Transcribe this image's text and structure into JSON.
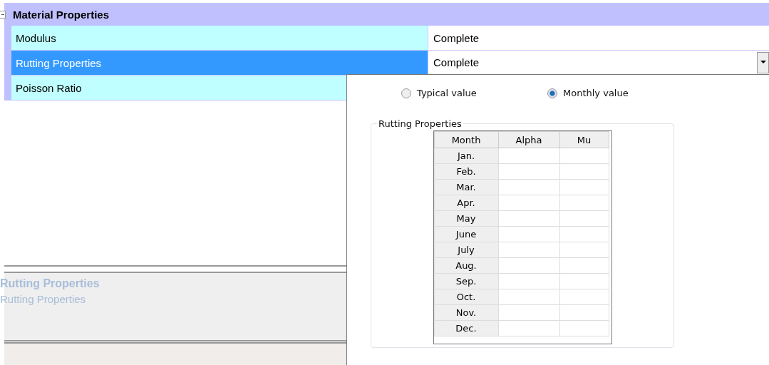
{
  "category": {
    "title": "Material Properties",
    "expanded": true
  },
  "properties": [
    {
      "name": "Modulus",
      "value": "Complete",
      "selected": false
    },
    {
      "name": "Rutting Properties",
      "value": "Complete",
      "selected": true
    },
    {
      "name": "Poisson Ratio",
      "selected": false
    }
  ],
  "description": {
    "title": "Rutting Properties",
    "text": "Rutting Properties"
  },
  "editor": {
    "options": [
      {
        "label": "Typical value",
        "selected": false
      },
      {
        "label": "Monthly value",
        "selected": true
      }
    ],
    "group_title": "Rutting Properties",
    "columns": [
      "Month",
      "Alpha",
      "Mu"
    ],
    "months": [
      "Jan.",
      "Feb.",
      "Mar.",
      "Apr.",
      "May",
      "June",
      "July",
      "Aug.",
      "Sep.",
      "Oct.",
      "Nov.",
      "Dec."
    ]
  }
}
